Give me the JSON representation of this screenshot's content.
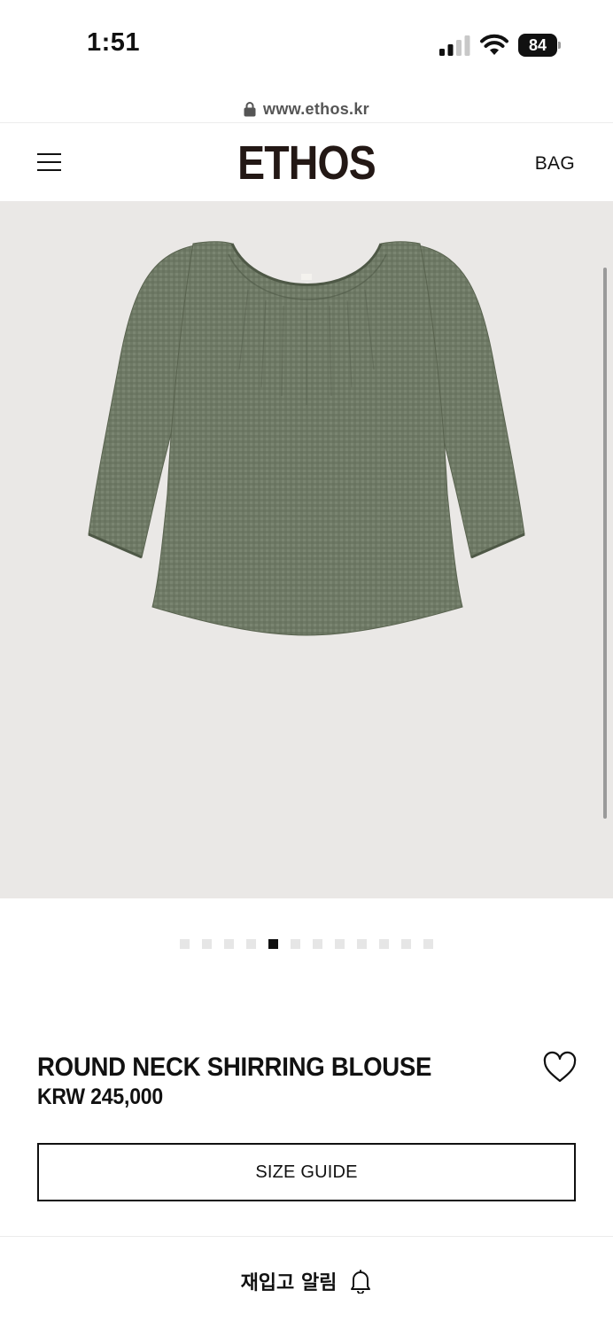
{
  "status_bar": {
    "time": "1:51",
    "battery_level": "84",
    "signal_bars_active": 2,
    "signal_bars_total": 4
  },
  "browser": {
    "url": "www.ethos.kr"
  },
  "header": {
    "menu_icon": "hamburger-menu-icon",
    "brand": "ETHOS",
    "bag_label": "BAG"
  },
  "gallery": {
    "image_subject": "green gingham blouse",
    "image_background": "#eae8e6",
    "total_images": 12,
    "active_index": 4
  },
  "product": {
    "name": "ROUND NECK SHIRRING BLOUSE",
    "price": "KRW 245,000",
    "wishlist_icon": "heart-outline-icon"
  },
  "actions": {
    "size_guide_label": "SIZE GUIDE",
    "restock_label": "재입고 알림",
    "restock_icon": "bell-icon"
  },
  "colors": {
    "text": "#111111",
    "logo": "#231815",
    "garment": "#6f7a66"
  }
}
